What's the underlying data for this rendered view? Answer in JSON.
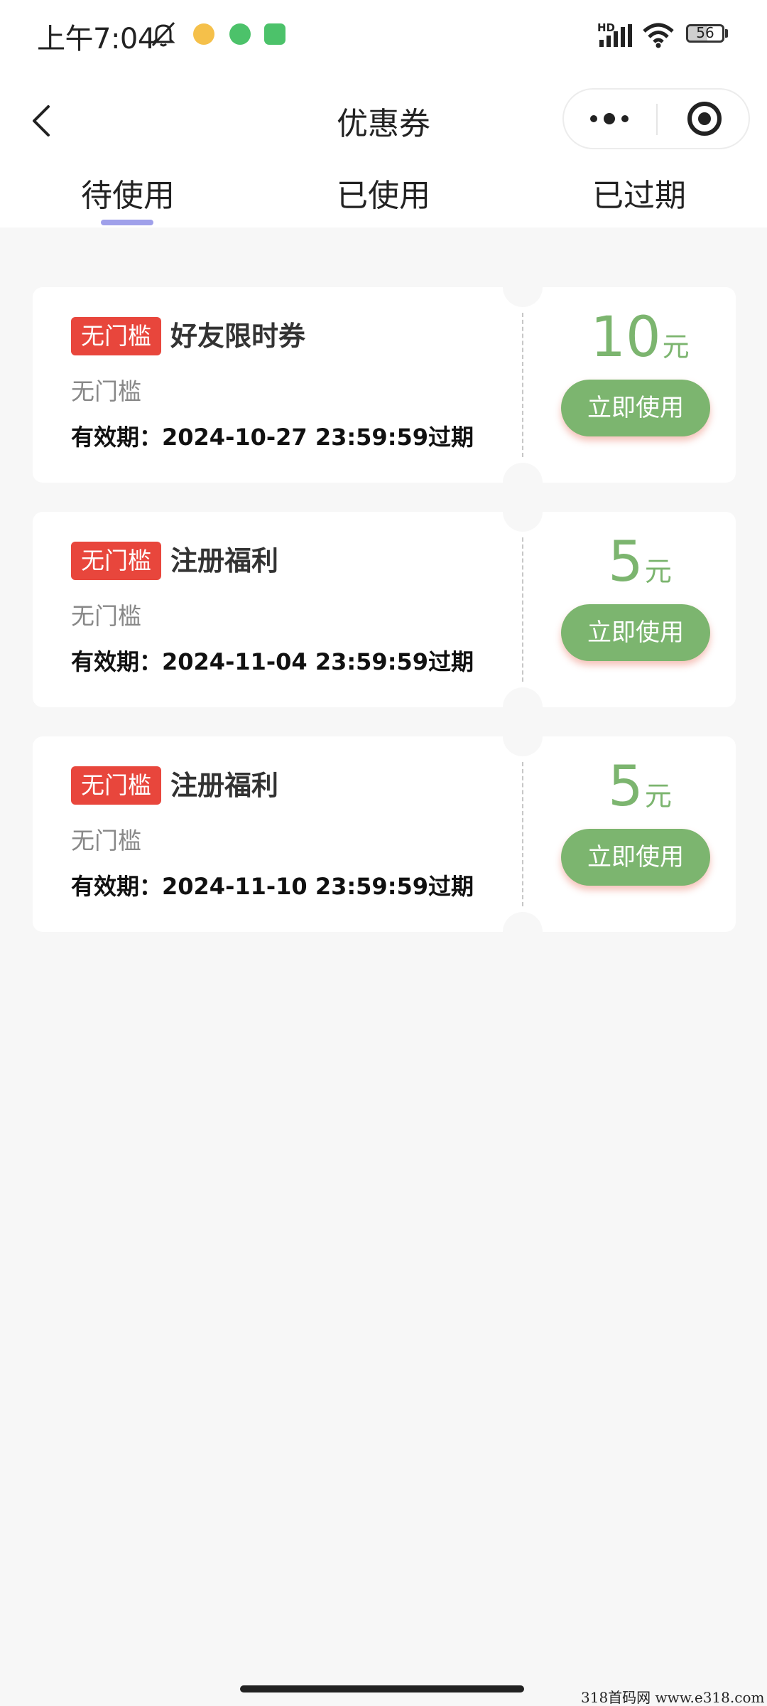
{
  "status_bar": {
    "time": "上午7:04",
    "hd_label": "HD",
    "battery_level": "56",
    "battery_fraction": 0.56
  },
  "nav": {
    "title": "优惠券"
  },
  "tabs": [
    {
      "label": "待使用",
      "active": true
    },
    {
      "label": "已使用",
      "active": false
    },
    {
      "label": "已过期",
      "active": false
    }
  ],
  "coupons": [
    {
      "tag": "无门槛",
      "name": "好友限时券",
      "condition": "无门槛",
      "expiry": "有效期：2024-10-27 23:59:59过期",
      "amount": "10",
      "unit": "元",
      "button": "立即使用"
    },
    {
      "tag": "无门槛",
      "name": "注册福利",
      "condition": "无门槛",
      "expiry": "有效期：2024-11-04 23:59:59过期",
      "amount": "5",
      "unit": "元",
      "button": "立即使用"
    },
    {
      "tag": "无门槛",
      "name": "注册福利",
      "condition": "无门槛",
      "expiry": "有效期：2024-11-10 23:59:59过期",
      "amount": "5",
      "unit": "元",
      "button": "立即使用"
    }
  ],
  "watermark": "318首码网  www.e318.com",
  "colors": {
    "accent_green": "#7cb56f",
    "tag_red": "#e8463c",
    "tab_indicator": "#9fa0ea"
  },
  "icons": {
    "back": "chevron-left-icon",
    "more": "more-dots-icon",
    "close": "target-circle-icon",
    "mute": "bell-mute-icon"
  }
}
